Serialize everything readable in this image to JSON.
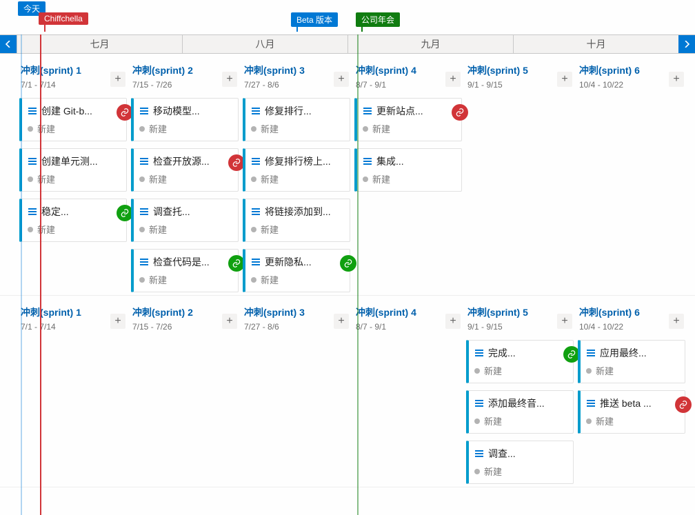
{
  "markers": {
    "today": "今天",
    "chiffchella": "Chiffchella",
    "beta": "Beta 版本",
    "conf": "公司年会"
  },
  "months": [
    "七月",
    "八月",
    "九月",
    "十月"
  ],
  "sprints": [
    {
      "title": "冲刺(sprint) 1",
      "range": "7/1 - 7/14"
    },
    {
      "title": "冲刺(sprint) 2",
      "range": "7/15 - 7/26"
    },
    {
      "title": "冲刺(sprint) 3",
      "range": "7/27 - 8/6"
    },
    {
      "title": "冲刺(sprint) 4",
      "range": "8/7 - 9/1"
    },
    {
      "title": "冲刺(sprint) 5",
      "range": "9/1 - 9/15"
    },
    {
      "title": "冲刺(sprint) 6",
      "range": "10/4 - 10/22"
    }
  ],
  "status_new": "新建",
  "add_label": "+",
  "row1": {
    "c0": [
      {
        "t": "创建 Git-b...",
        "b": "red"
      },
      {
        "t": "创建单元测..."
      },
      {
        "t": "稳定...",
        "b": "green"
      }
    ],
    "c1": [
      {
        "t": "移动模型..."
      },
      {
        "t": "检查开放源...",
        "b": "red"
      },
      {
        "t": "调查托..."
      },
      {
        "t": "检查代码是...",
        "b": "green"
      }
    ],
    "c2": [
      {
        "t": "修复排行..."
      },
      {
        "t": "修复排行榜上..."
      },
      {
        "t": "将链接添加到..."
      },
      {
        "t": "更新隐私...",
        "b": "green"
      }
    ],
    "c3": [
      {
        "t": "更新站点...",
        "b": "red"
      },
      {
        "t": "集成..."
      }
    ],
    "c4": [],
    "c5": []
  },
  "row2": {
    "c0": [],
    "c1": [],
    "c2": [],
    "c3": [],
    "c4": [
      {
        "t": "完成...",
        "b": "green"
      },
      {
        "t": "添加最终音..."
      },
      {
        "t": "调查..."
      }
    ],
    "c5": [
      {
        "t": "应用最终..."
      },
      {
        "t": "推送 beta ...",
        "b": "red"
      }
    ]
  }
}
